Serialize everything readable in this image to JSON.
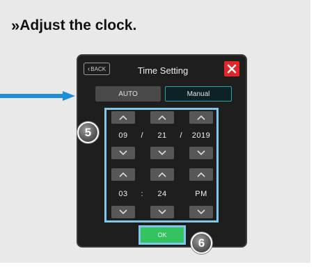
{
  "instruction": {
    "bullet": "»",
    "text": "Adjust the clock."
  },
  "screen": {
    "back_label": "BACK",
    "title": "Time Setting",
    "mode_auto": "AUTO",
    "mode_manual": "Manual",
    "selected_mode": "Manual",
    "ok_label": "OK"
  },
  "date": {
    "month": "09",
    "day": "21",
    "year": "2019",
    "separator": "/"
  },
  "time": {
    "hour": "03",
    "minute": "24",
    "period": "PM",
    "separator": ":"
  },
  "callouts": {
    "step5": "5",
    "step6": "6"
  },
  "colors": {
    "highlight": "#7fc8ea",
    "arrow": "#1e8fd6",
    "ok_button": "#34c160",
    "close_button": "#e2262a",
    "manual_border": "#2fa0a6"
  }
}
